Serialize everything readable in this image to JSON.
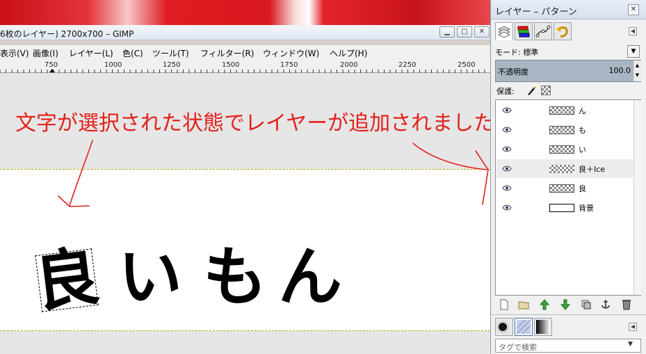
{
  "main_window": {
    "title": "6枚のレイヤー) 2700x700 – GIMP",
    "menu": [
      "表示(V)",
      "画像(I)",
      "レイヤー(L)",
      "色(C)",
      "ツール(T)",
      "フィルター(R)",
      "ウィンドウ(W)",
      "ヘルプ(H)"
    ],
    "ruler_ticks": [
      "750",
      "1000",
      "1250",
      "1500",
      "1750",
      "2000",
      "2250",
      "2500"
    ],
    "canvas_text": [
      "良",
      "い",
      "も",
      "ん"
    ]
  },
  "annotation": {
    "text": "文字が選択された状態でレイヤーが追加されました",
    "color": "#e3201b"
  },
  "layers_dialog": {
    "title": "レイヤー – パターン",
    "mode_label": "モード: 標準",
    "opacity_label": "不透明度",
    "opacity_value": "100.0",
    "lock_label": "保護:",
    "layers": [
      {
        "name": "ん",
        "visible": true,
        "selected": false,
        "thumb": "checker"
      },
      {
        "name": "も",
        "visible": true,
        "selected": false,
        "thumb": "checker"
      },
      {
        "name": "い",
        "visible": true,
        "selected": false,
        "thumb": "checker"
      },
      {
        "name": "良＋Ice",
        "visible": true,
        "selected": true,
        "thumb": "checker"
      },
      {
        "name": "良",
        "visible": true,
        "selected": false,
        "thumb": "checker"
      },
      {
        "name": "背景",
        "visible": true,
        "selected": false,
        "thumb": "white"
      }
    ],
    "tag_filter_placeholder": "タグで検索"
  },
  "colors": {
    "accent_red": "#e3201b",
    "selection_dash": "#b7a700"
  }
}
